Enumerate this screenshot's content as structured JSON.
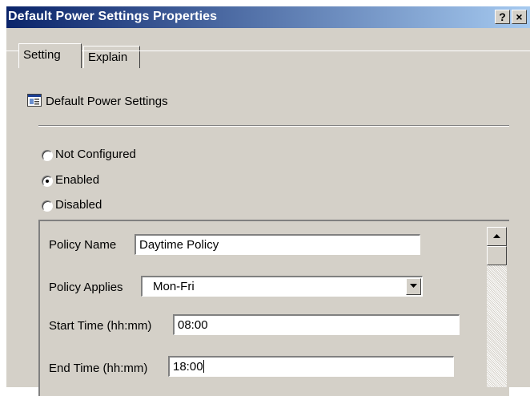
{
  "window": {
    "title": "Default Power Settings Properties",
    "help_button": "?",
    "close_button": "×"
  },
  "tabs": [
    {
      "label": "Setting",
      "active": true
    },
    {
      "label": "Explain",
      "active": false
    }
  ],
  "header": {
    "icon": "policy-settings-icon",
    "label": "Default Power Settings"
  },
  "state_options": [
    {
      "label": "Not Configured",
      "selected": false
    },
    {
      "label": "Enabled",
      "selected": true
    },
    {
      "label": "Disabled",
      "selected": false
    }
  ],
  "options": {
    "policy_name": {
      "label": "Policy Name",
      "value": "Daytime Policy"
    },
    "policy_applies": {
      "label": "Policy Applies",
      "value": "Mon-Fri"
    },
    "start_time": {
      "label": "Start Time (hh:mm)",
      "value": "08:00"
    },
    "end_time": {
      "label": "End Time (hh:mm)",
      "value": "18:00"
    }
  },
  "colors": {
    "title_gradient_start": "#0a246a",
    "title_gradient_end": "#a6caf0",
    "dialog_face": "#d4d0c8"
  }
}
